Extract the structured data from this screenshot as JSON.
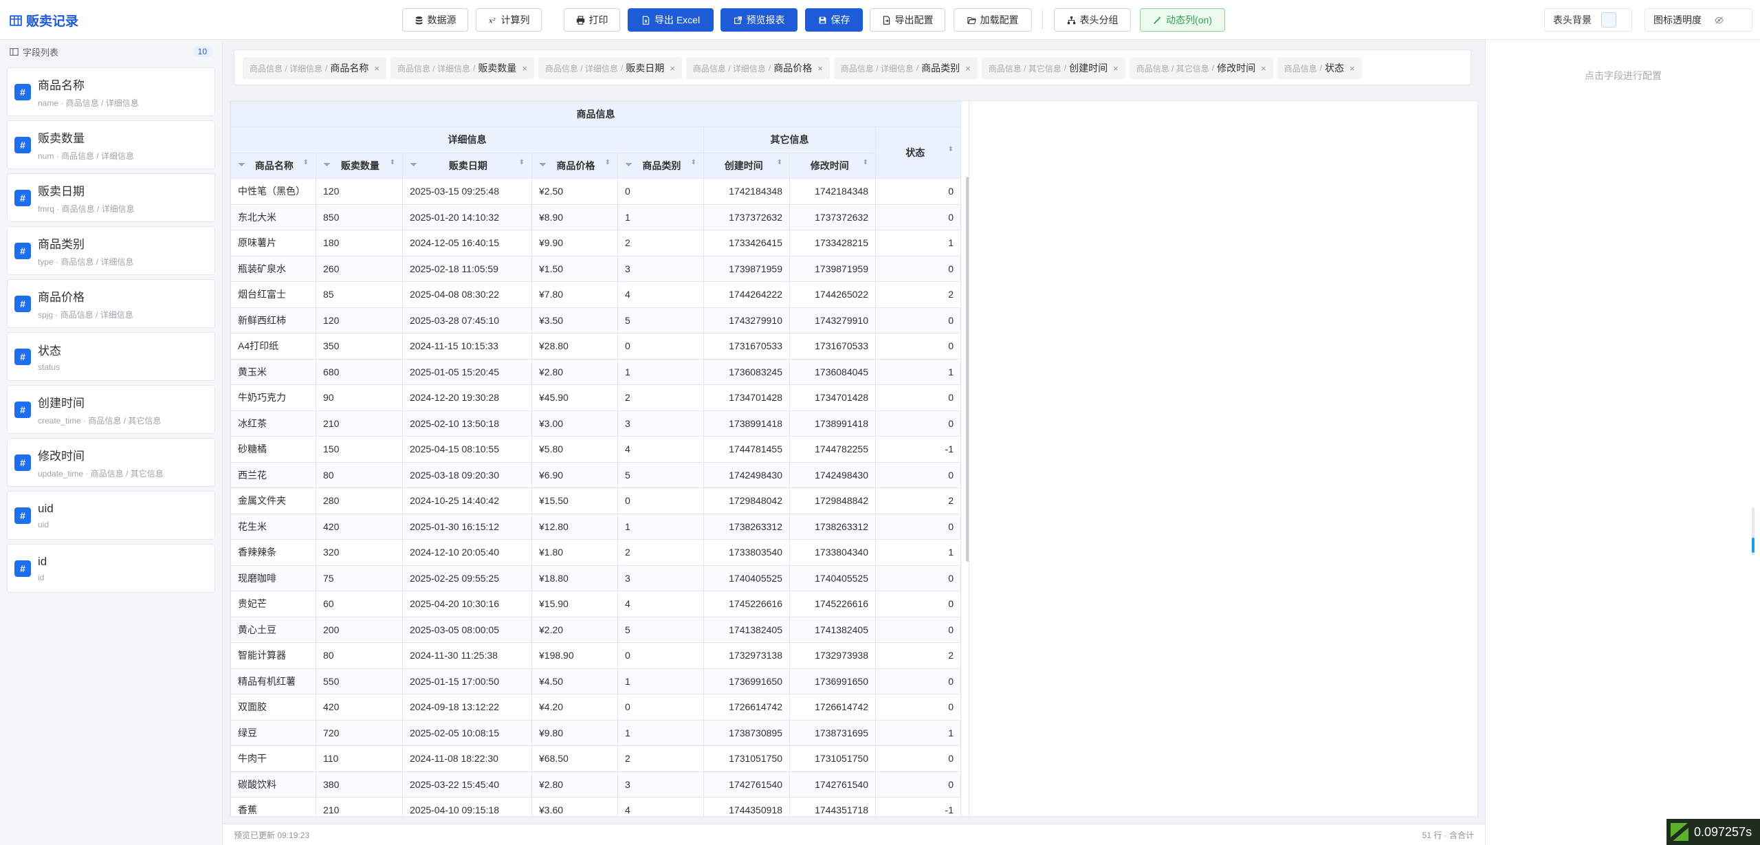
{
  "app": {
    "title": "贩卖记录"
  },
  "toolbar": {
    "datasource": "数据源",
    "calc_column": "计算列",
    "print": "打印",
    "export_excel": "导出 Excel",
    "preview_report": "预览报表",
    "save": "保存",
    "export_config": "导出配置",
    "load_config": "加载配置",
    "header_group": "表头分组",
    "dynamic_column": "动态列(on)",
    "header_bg": "表头背景",
    "icon_opacity": "图标透明度"
  },
  "sidebar": {
    "title": "字段列表",
    "count": "10",
    "fields": [
      {
        "name": "商品名称",
        "key": "name",
        "path": "商品信息 / 详细信息"
      },
      {
        "name": "贩卖数量",
        "key": "num",
        "path": "商品信息 / 详细信息"
      },
      {
        "name": "贩卖日期",
        "key": "fmrq",
        "path": "商品信息 / 详细信息"
      },
      {
        "name": "商品类别",
        "key": "type",
        "path": "商品信息 / 详细信息"
      },
      {
        "name": "商品价格",
        "key": "spjg",
        "path": "商品信息 / 详细信息"
      },
      {
        "name": "状态",
        "key": "status",
        "path": ""
      },
      {
        "name": "创建时间",
        "key": "create_time",
        "path": "商品信息 / 其它信息"
      },
      {
        "name": "修改时间",
        "key": "update_time",
        "path": "商品信息 / 其它信息"
      },
      {
        "name": "uid",
        "key": "uid",
        "path": ""
      },
      {
        "name": "id",
        "key": "id",
        "path": ""
      }
    ]
  },
  "chips": [
    {
      "path": "商品信息 / 详细信息",
      "label": "商品名称"
    },
    {
      "path": "商品信息 / 详细信息",
      "label": "贩卖数量"
    },
    {
      "path": "商品信息 / 详细信息",
      "label": "贩卖日期"
    },
    {
      "path": "商品信息 / 详细信息",
      "label": "商品价格"
    },
    {
      "path": "商品信息 / 详细信息",
      "label": "商品类别"
    },
    {
      "path": "商品信息 / 其它信息",
      "label": "创建时间"
    },
    {
      "path": "商品信息 / 其它信息",
      "label": "修改时间"
    },
    {
      "path": "商品信息",
      "label": "状态"
    }
  ],
  "table": {
    "group_top": "商品信息",
    "group_detail": "详细信息",
    "group_other": "其它信息",
    "columns": [
      "商品名称",
      "贩卖数量",
      "贩卖日期",
      "商品价格",
      "商品类别",
      "创建时间",
      "修改时间",
      "状态"
    ],
    "rows": [
      [
        "中性笔（黑色）",
        "120",
        "2025-03-15 09:25:48",
        "¥2.50",
        "0",
        "1742184348",
        "1742184348",
        "0"
      ],
      [
        "东北大米",
        "850",
        "2025-01-20 14:10:32",
        "¥8.90",
        "1",
        "1737372632",
        "1737372632",
        "0"
      ],
      [
        "原味薯片",
        "180",
        "2024-12-05 16:40:15",
        "¥9.90",
        "2",
        "1733426415",
        "1733428215",
        "1"
      ],
      [
        "瓶装矿泉水",
        "260",
        "2025-02-18 11:05:59",
        "¥1.50",
        "3",
        "1739871959",
        "1739871959",
        "0"
      ],
      [
        "烟台红富士",
        "85",
        "2025-04-08 08:30:22",
        "¥7.80",
        "4",
        "1744264222",
        "1744265022",
        "2"
      ],
      [
        "新鲜西红柿",
        "120",
        "2025-03-28 07:45:10",
        "¥3.50",
        "5",
        "1743279910",
        "1743279910",
        "0"
      ],
      [
        "A4打印纸",
        "350",
        "2024-11-15 10:15:33",
        "¥28.80",
        "0",
        "1731670533",
        "1731670533",
        "0"
      ],
      [
        "黄玉米",
        "680",
        "2025-01-05 15:20:45",
        "¥2.80",
        "1",
        "1736083245",
        "1736084045",
        "1"
      ],
      [
        "牛奶巧克力",
        "90",
        "2024-12-20 19:30:28",
        "¥45.90",
        "2",
        "1734701428",
        "1734701428",
        "0"
      ],
      [
        "冰红茶",
        "210",
        "2025-02-10 13:50:18",
        "¥3.00",
        "3",
        "1738991418",
        "1738991418",
        "0"
      ],
      [
        "砂糖橘",
        "150",
        "2025-04-15 08:10:55",
        "¥5.80",
        "4",
        "1744781455",
        "1744782255",
        "-1"
      ],
      [
        "西兰花",
        "80",
        "2025-03-18 09:20:30",
        "¥6.90",
        "5",
        "1742498430",
        "1742498430",
        "0"
      ],
      [
        "金属文件夹",
        "280",
        "2024-10-25 14:40:42",
        "¥15.50",
        "0",
        "1729848042",
        "1729848842",
        "2"
      ],
      [
        "花生米",
        "420",
        "2025-01-30 16:15:12",
        "¥12.80",
        "1",
        "1738263312",
        "1738263312",
        "0"
      ],
      [
        "香辣辣条",
        "320",
        "2024-12-10 20:05:40",
        "¥1.80",
        "2",
        "1733803540",
        "1733804340",
        "1"
      ],
      [
        "现磨咖啡",
        "75",
        "2025-02-25 09:55:25",
        "¥18.80",
        "3",
        "1740405525",
        "1740405525",
        "0"
      ],
      [
        "贵妃芒",
        "60",
        "2025-04-20 10:30:16",
        "¥15.90",
        "4",
        "1745226616",
        "1745226616",
        "0"
      ],
      [
        "黄心土豆",
        "200",
        "2025-03-05 08:00:05",
        "¥2.20",
        "5",
        "1741382405",
        "1741382405",
        "0"
      ],
      [
        "智能计算器",
        "80",
        "2024-11-30 11:25:38",
        "¥198.90",
        "0",
        "1732973138",
        "1732973938",
        "2"
      ],
      [
        "精品有机红薯",
        "550",
        "2025-01-15 17:00:50",
        "¥4.50",
        "1",
        "1736991650",
        "1736991650",
        "0"
      ],
      [
        "双面胶",
        "420",
        "2024-09-18 13:12:22",
        "¥4.20",
        "0",
        "1726614742",
        "1726614742",
        "0"
      ],
      [
        "绿豆",
        "720",
        "2025-02-05 10:08:15",
        "¥9.80",
        "1",
        "1738730895",
        "1738731695",
        "1"
      ],
      [
        "牛肉干",
        "110",
        "2024-11-08 18:22:30",
        "¥68.50",
        "2",
        "1731051750",
        "1731051750",
        "0"
      ],
      [
        "碳酸饮料",
        "380",
        "2025-03-22 15:45:40",
        "¥2.80",
        "3",
        "1742761540",
        "1742761540",
        "0"
      ],
      [
        "香蕉",
        "210",
        "2025-04-10 09:15:18",
        "¥3.60",
        "4",
        "1744350918",
        "1744351718",
        "-1"
      ]
    ]
  },
  "status": {
    "updated": "预览已更新 09:19:23",
    "summary": "51 行 · 含合计"
  },
  "config": {
    "hint": "点击字段进行配置"
  },
  "perf": {
    "value": "0.097257s"
  },
  "colors": {
    "brand": "#1e5bd6",
    "success": "#2ea44f",
    "header_bg": "#ecf2fd"
  }
}
